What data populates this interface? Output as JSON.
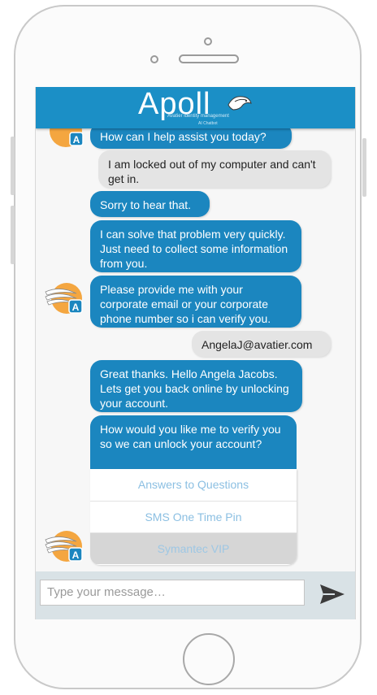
{
  "brand": {
    "name": "Apoll",
    "tagline": "Avatier identity management",
    "tagline2": "AI Chatbot"
  },
  "messages": [
    {
      "sender": "bot",
      "text": "How can I help assist you today?"
    },
    {
      "sender": "user",
      "text": "I am locked out of my computer and can't get in."
    },
    {
      "sender": "bot",
      "text": "Sorry to hear that."
    },
    {
      "sender": "bot",
      "text": "I can solve that problem very quickly.  Just need to collect some information from you."
    },
    {
      "sender": "bot",
      "text": "Please provide me with your corporate email or your corporate phone number so i can verify you."
    },
    {
      "sender": "user",
      "text": "AngelaJ@avatier.com"
    },
    {
      "sender": "bot",
      "text": "Great thanks.  Hello Angela Jacobs.  Lets get you back online by unlocking your account."
    },
    {
      "sender": "bot",
      "text": "How would you like me to verify you so we can unlock your account?"
    }
  ],
  "options": [
    {
      "label": "Answers to Questions"
    },
    {
      "label": "SMS One Time Pin"
    },
    {
      "label": "Symantec VIP"
    }
  ],
  "composer": {
    "placeholder": "Type your message…"
  },
  "colors": {
    "accent": "#1b8fc6",
    "bot_bubble": "#1b86bf",
    "user_bubble": "#e4e4e4",
    "avatar_orange": "#f4a640"
  },
  "icons": {
    "avatar": "winged-a-avatar-icon",
    "send": "send-arrow-icon",
    "logo_bird": "bird-icon"
  }
}
